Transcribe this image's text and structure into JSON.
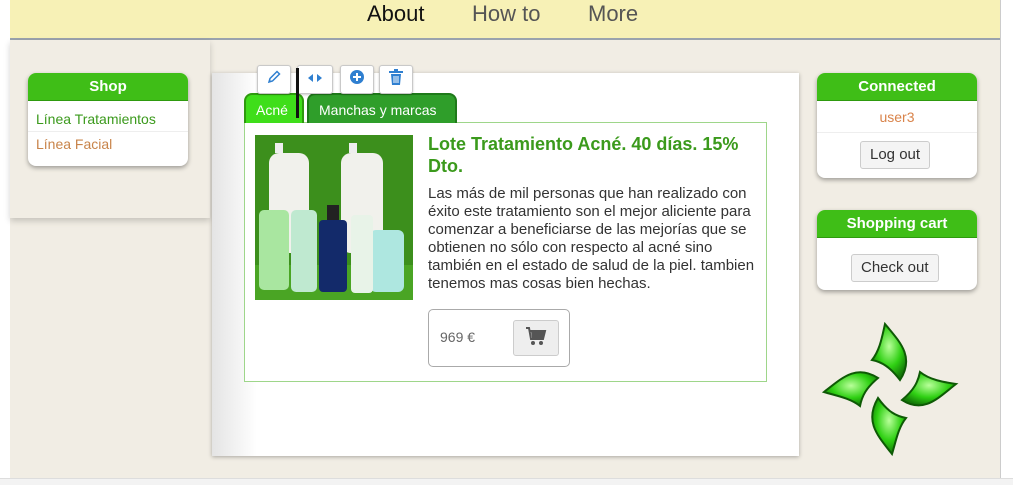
{
  "nav": {
    "items": [
      "About",
      "How to",
      "More"
    ]
  },
  "shop": {
    "title": "Shop",
    "items": [
      "Línea Tratamientos",
      "Línea Facial"
    ]
  },
  "connected": {
    "title": "Connected",
    "user": "user3",
    "logout_label": "Log out"
  },
  "cart": {
    "title": "Shopping cart",
    "checkout_label": "Check out"
  },
  "toolbar": {
    "icons": [
      "pencil-icon",
      "resize-horizontal-icon",
      "plus-circle-icon",
      "trash-icon"
    ]
  },
  "tabs": [
    {
      "label": "Acné",
      "active": true
    },
    {
      "label": "Manchas y marcas",
      "active": false
    }
  ],
  "product": {
    "title": "Lote Tratamiento Acné. 40 días. 15% Dto.",
    "description": "Las más de mil personas que han realizado con éxito este tratamiento son el mejor aliciente para comenzar a beneficiarse de las mejorías que se obtienen no sólo con respecto al acné sino también en el estado de salud de la piel. tambien tenemos mas cosas bien hechas.",
    "price": "969 €",
    "cart_icon": "shopping-cart-icon"
  },
  "colors": {
    "brand_green": "#3fbe17",
    "nav_bg": "#f7f1b6",
    "link_orange": "#c8844a"
  }
}
